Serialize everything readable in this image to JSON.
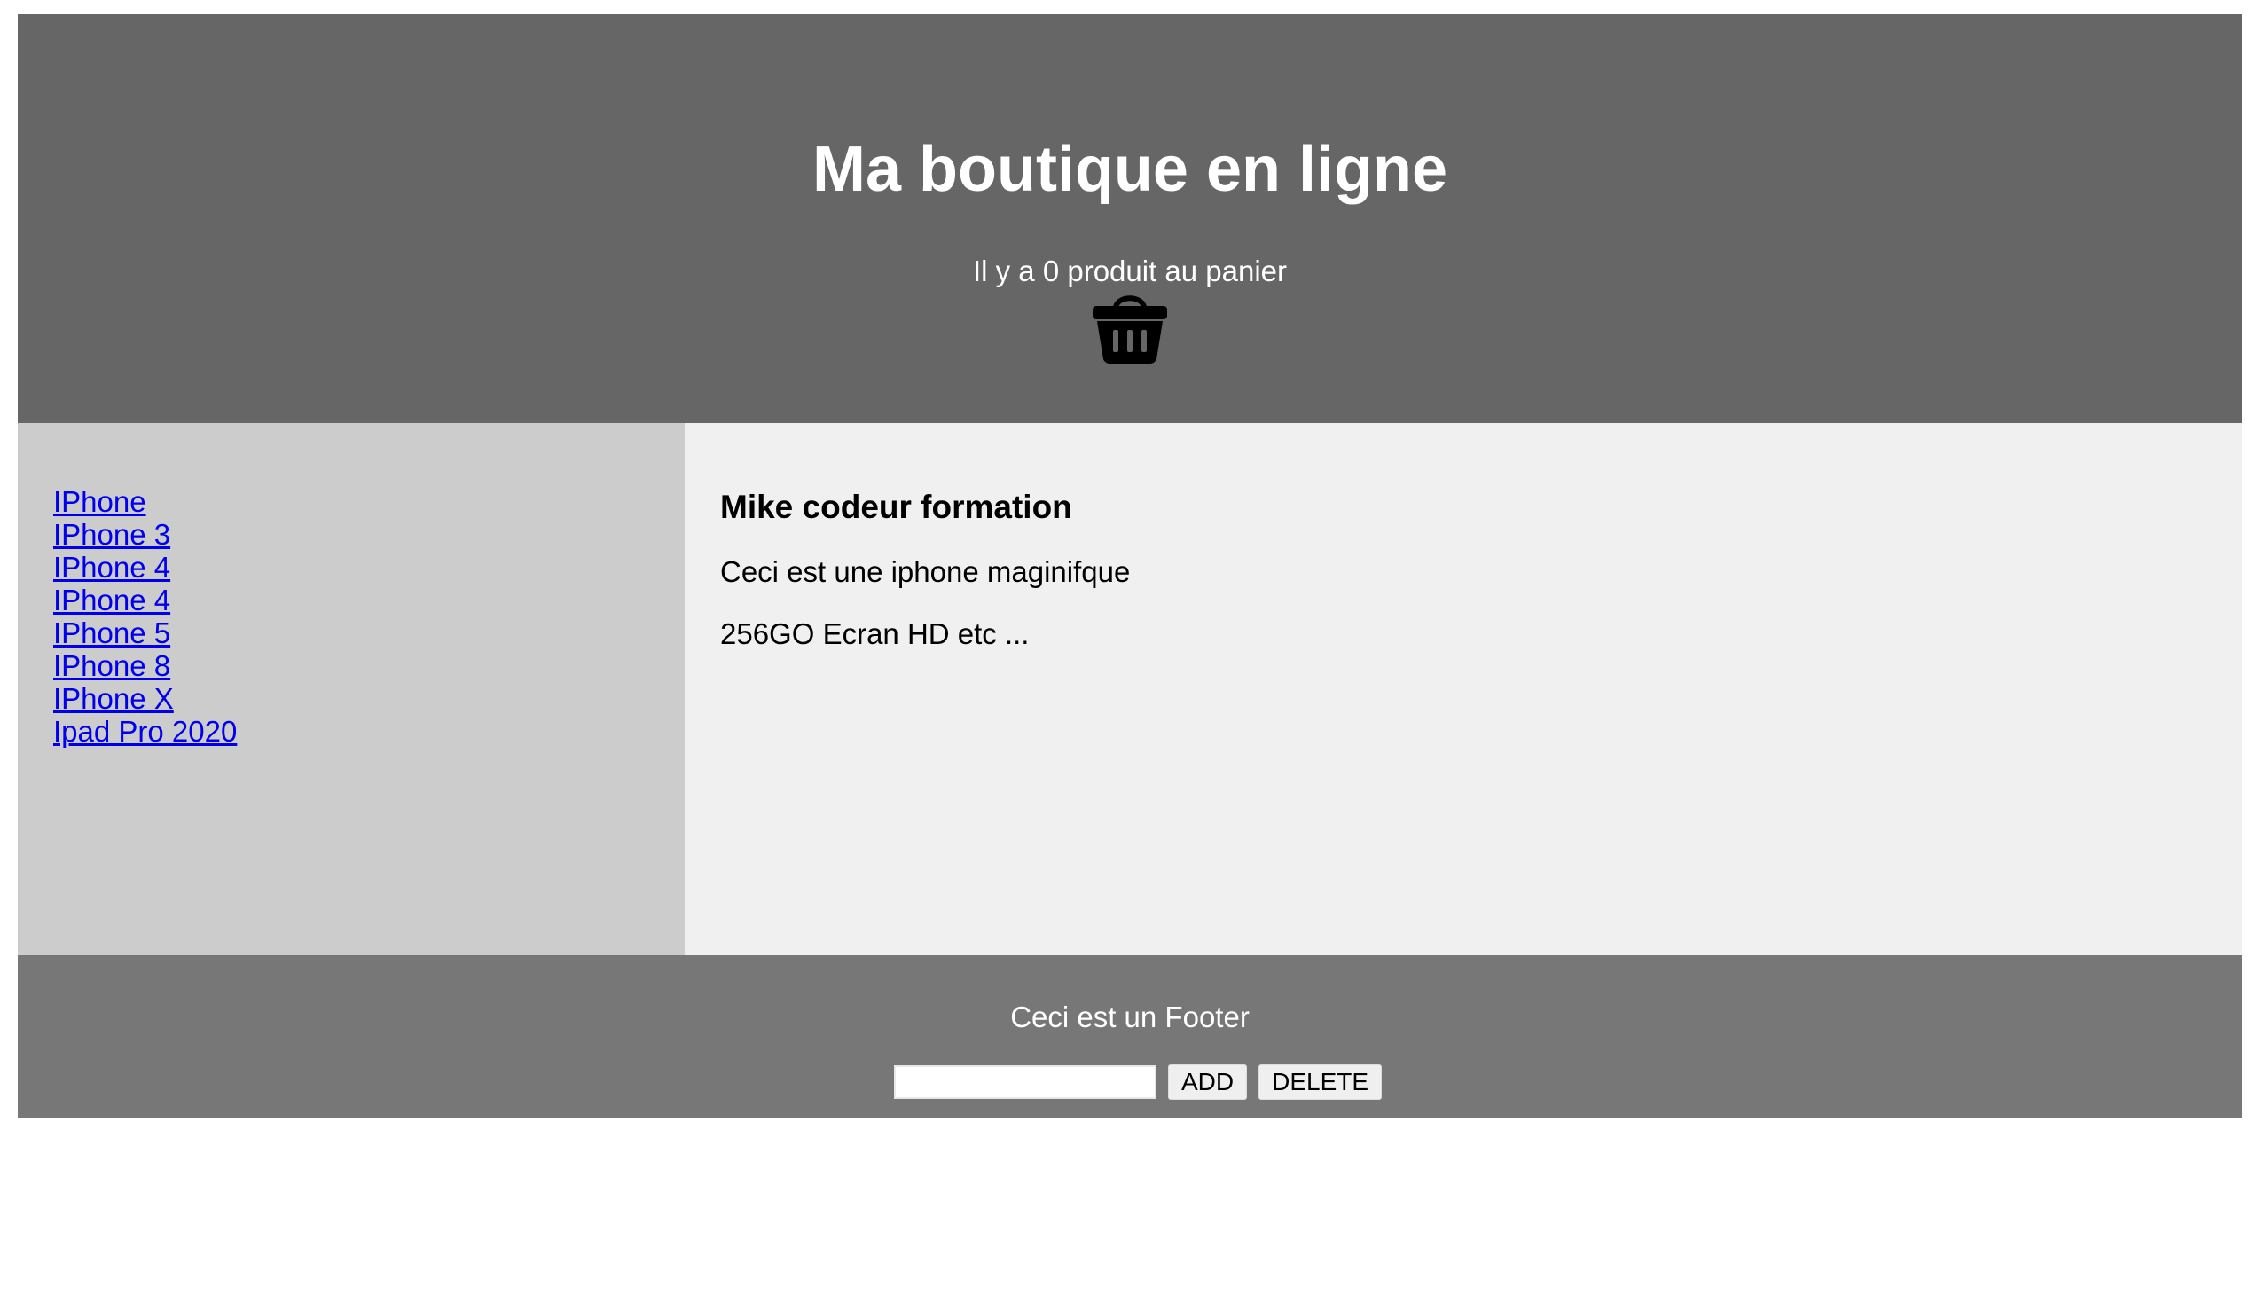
{
  "header": {
    "title": "Ma boutique en ligne",
    "cart_text": "Il y a 0 produit au panier",
    "cart_icon": "basket-icon",
    "background": "#666666"
  },
  "sidebar": {
    "background": "#cccccc",
    "links": [
      "IPhone",
      "IPhone 3",
      "IPhone 4",
      "IPhone 4",
      "IPhone 5",
      "IPhone 8",
      "IPhone X",
      "Ipad Pro 2020"
    ]
  },
  "content": {
    "background": "#f0f0f0",
    "heading": "Mike codeur formation",
    "description": "Ceci est une iphone maginifque",
    "specs": "256GO Ecran HD etc ..."
  },
  "footer": {
    "background": "#777777",
    "text": "Ceci est un Footer",
    "input_value": "",
    "add_label": "ADD",
    "delete_label": "DELETE"
  }
}
